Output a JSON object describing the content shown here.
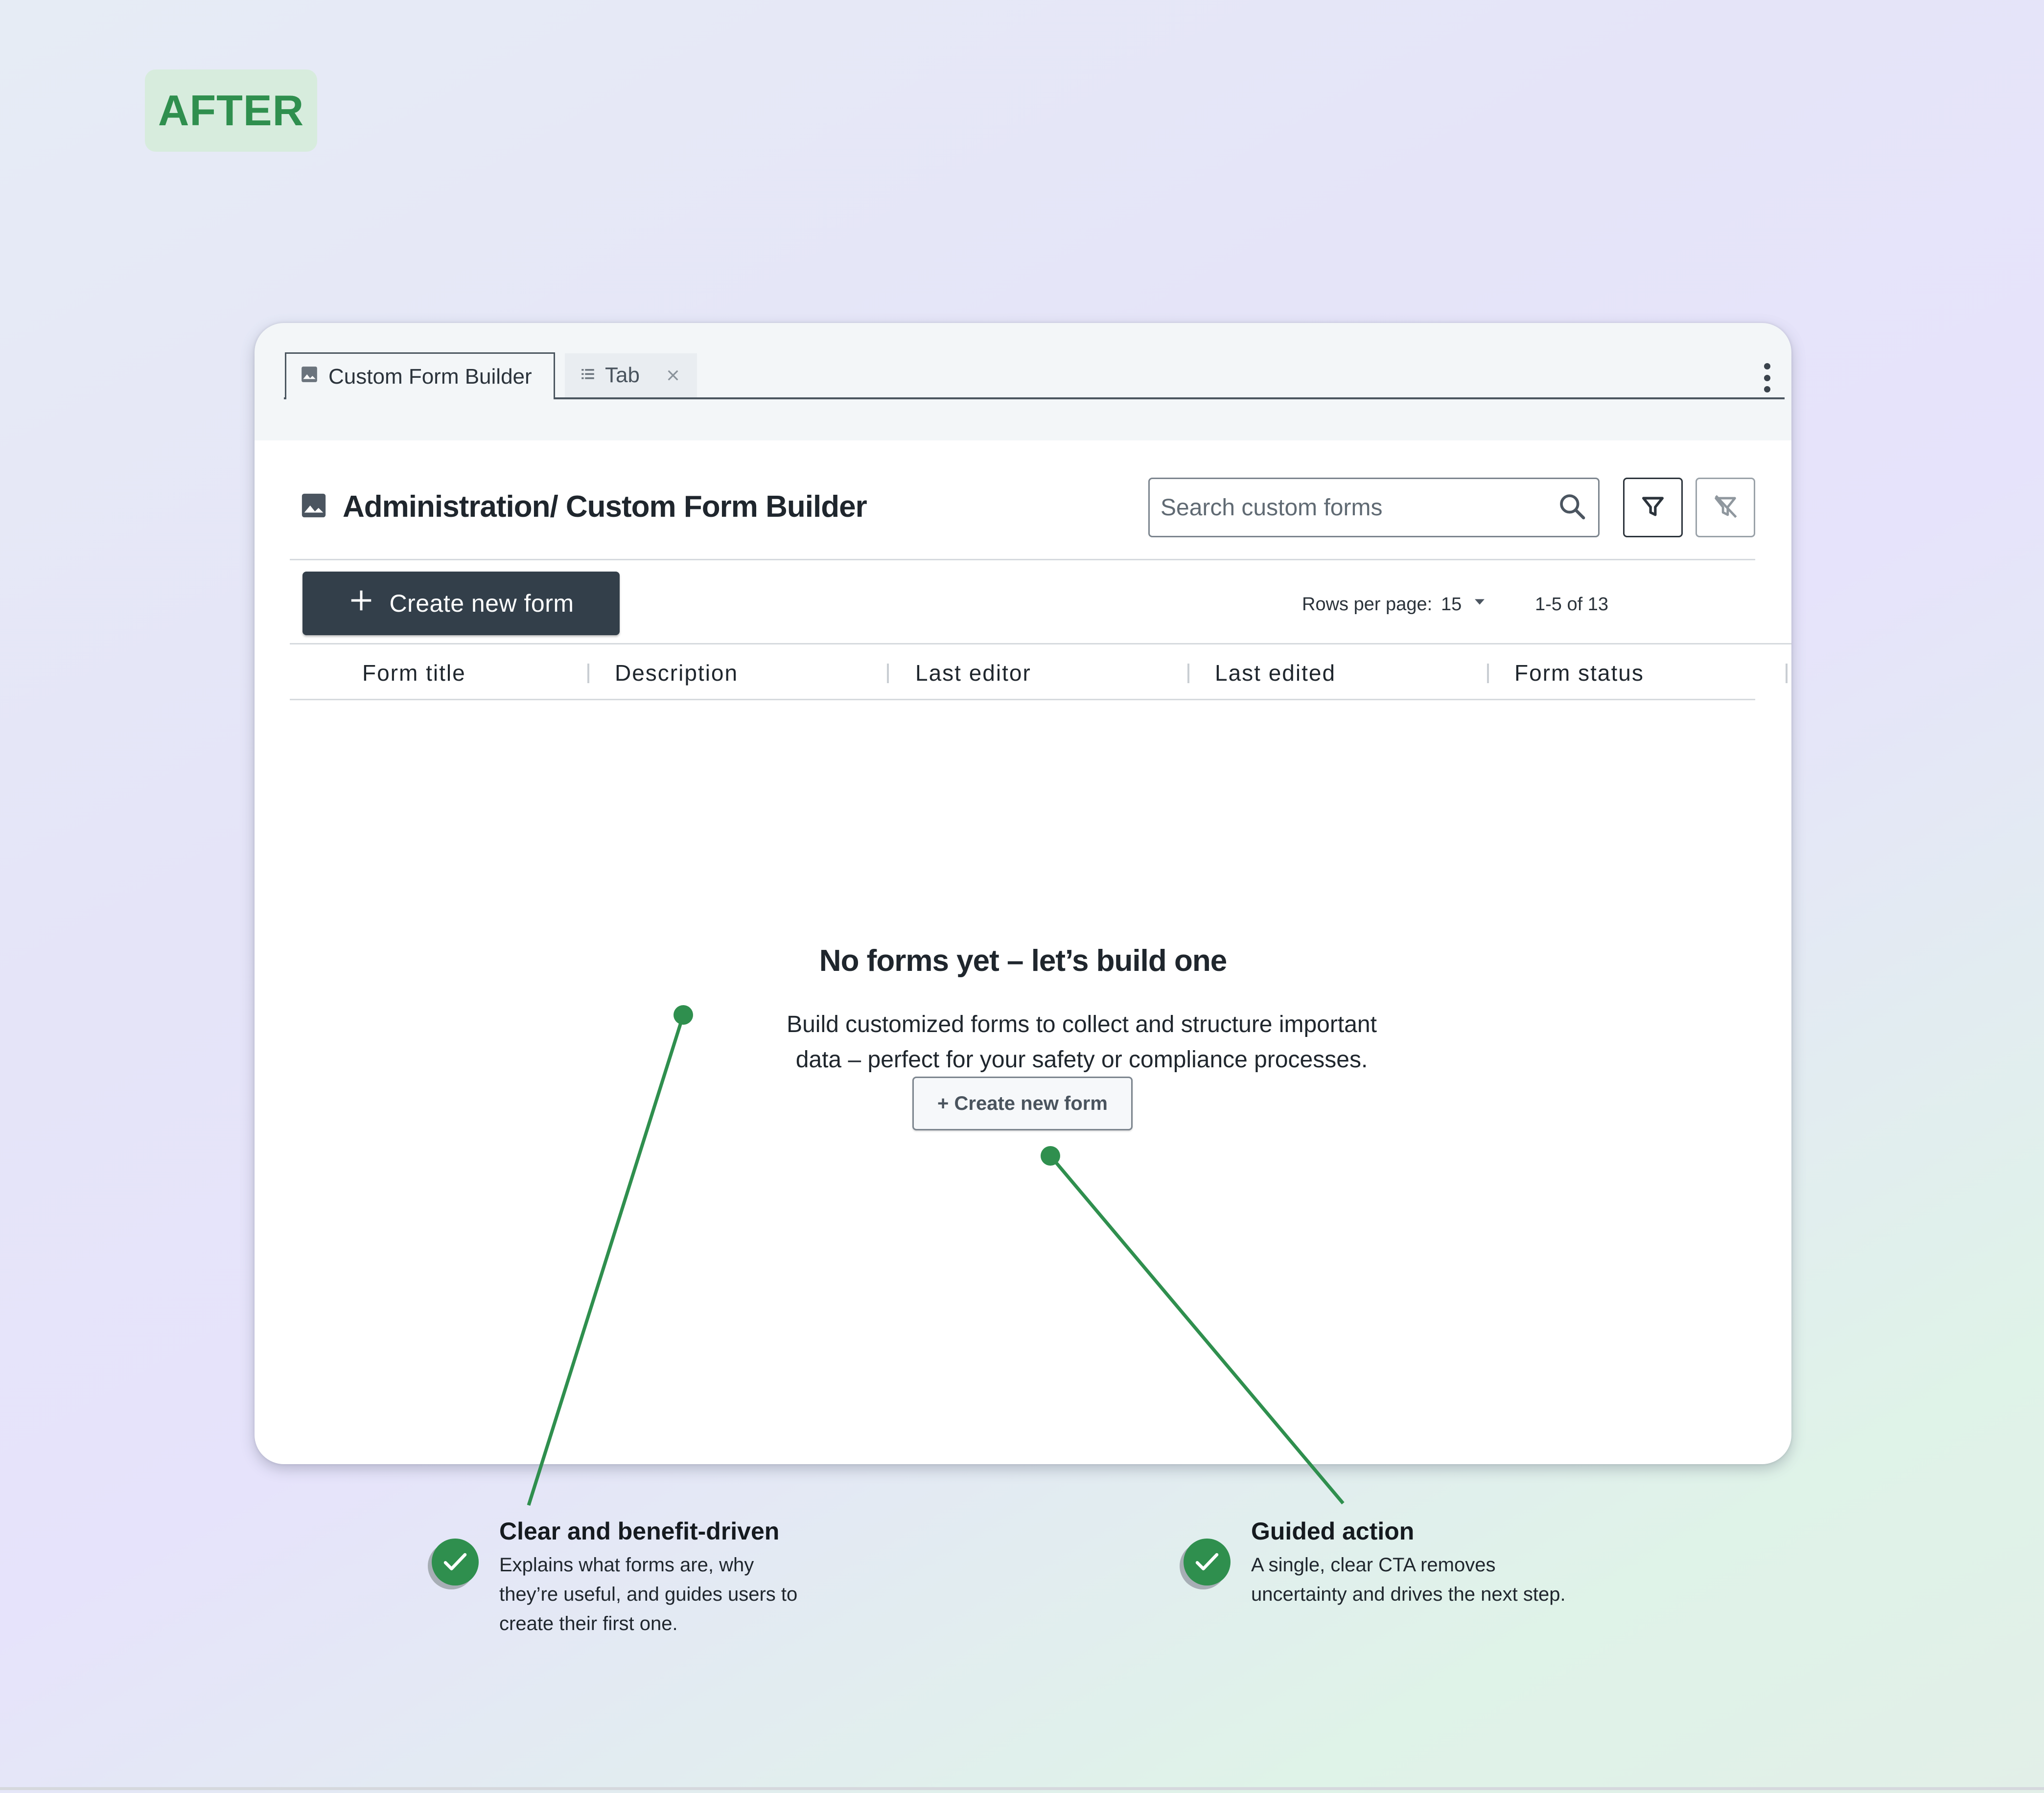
{
  "badge": {
    "label": "AFTER"
  },
  "tabs": [
    {
      "label": "Custom Form Builder",
      "icon": "image-icon"
    },
    {
      "label": "Tab",
      "icon": "list-icon"
    }
  ],
  "header": {
    "title": "Administration/ Custom Form Builder",
    "search_placeholder": "Search custom forms"
  },
  "toolbar": {
    "create_label": "Create new form",
    "rows_label": "Rows per page:",
    "rows_value": "15",
    "range": "1-5 of 13"
  },
  "table": {
    "columns": [
      "Form title",
      "Description",
      "Last editor",
      "Last edited",
      "Form status"
    ]
  },
  "empty_state": {
    "title": "No forms yet – let’s build one",
    "description_line1": "Build customized forms to collect and structure important",
    "description_line2": "data – perfect for your safety or compliance processes.",
    "button_label": "+ Create new form"
  },
  "callouts": [
    {
      "title": "Clear and benefit-driven",
      "lines": [
        "Explains what forms are, why",
        "they’re useful, and guides users to",
        "create their first one."
      ]
    },
    {
      "title": "Guided action",
      "lines": [
        "A single, clear CTA removes",
        "uncertainty and drives the next step."
      ]
    }
  ],
  "colors": {
    "accent_green": "#2f8f4e",
    "primary_button": "#333f4a"
  }
}
